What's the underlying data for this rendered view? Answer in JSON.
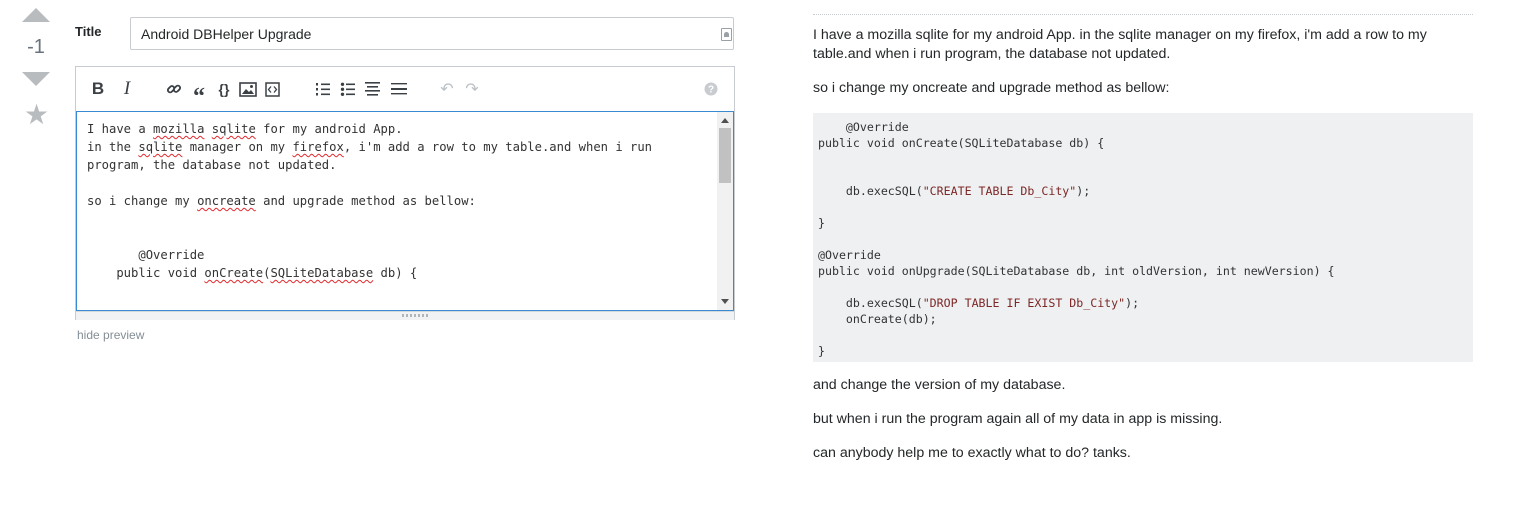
{
  "vote": {
    "score": "-1"
  },
  "title": {
    "label": "Title",
    "value": "Android DBHelper Upgrade"
  },
  "toolbar": {
    "bold_label": "B",
    "italic_label": "I",
    "icons": [
      "link-icon",
      "quote-icon",
      "code-icon",
      "image-icon",
      "snippet-icon",
      "ordered-list-icon",
      "bulleted-list-icon",
      "heading-icon",
      "horizontal-rule-icon",
      "undo-icon",
      "redo-icon",
      "help-icon"
    ]
  },
  "editor": {
    "lines": [
      {
        "parts": [
          {
            "t": "I have a "
          },
          {
            "t": "mozilla",
            "s": true
          },
          {
            "t": " "
          },
          {
            "t": "sqlite",
            "s": true
          },
          {
            "t": " for my android App."
          }
        ]
      },
      {
        "parts": [
          {
            "t": "in the "
          },
          {
            "t": "sqlite",
            "s": true
          },
          {
            "t": " manager on my "
          },
          {
            "t": "firefox",
            "s": true
          },
          {
            "t": ", i'm add a row to my table.and when i run"
          }
        ]
      },
      {
        "parts": [
          {
            "t": "program, the database not updated."
          }
        ]
      },
      {
        "parts": [
          {
            "t": ""
          }
        ]
      },
      {
        "parts": [
          {
            "t": "so i change my "
          },
          {
            "t": "oncreate",
            "s": true
          },
          {
            "t": " and upgrade method as bellow:"
          }
        ]
      },
      {
        "parts": [
          {
            "t": ""
          }
        ]
      },
      {
        "parts": [
          {
            "t": ""
          }
        ]
      },
      {
        "parts": [
          {
            "t": "       @Override"
          }
        ]
      },
      {
        "parts": [
          {
            "t": "    public void "
          },
          {
            "t": "onCreate",
            "s": true
          },
          {
            "t": "("
          },
          {
            "t": "SQLiteDatabase",
            "s": true
          },
          {
            "t": " db) {"
          }
        ]
      },
      {
        "parts": [
          {
            "t": ""
          }
        ]
      }
    ]
  },
  "hide_preview_label": "hide preview",
  "preview": {
    "p1": "I have a mozilla sqlite for my android App. in the sqlite manager on my firefox, i'm add a row to my table.and when i run program, the database not updated.",
    "p2": "so i change my oncreate and upgrade method as bellow:",
    "code": [
      {
        "parts": [
          {
            "t": "    @Override"
          }
        ]
      },
      {
        "parts": [
          {
            "t": "public void onCreate(SQLiteDatabase db) {"
          }
        ]
      },
      {
        "parts": [
          {
            "t": ""
          }
        ]
      },
      {
        "parts": [
          {
            "t": ""
          }
        ]
      },
      {
        "parts": [
          {
            "t": "    db.execSQL("
          },
          {
            "t": "\"CREATE TABLE Db_City\"",
            "str": true
          },
          {
            "t": ");"
          }
        ]
      },
      {
        "parts": [
          {
            "t": ""
          }
        ]
      },
      {
        "parts": [
          {
            "t": "}"
          }
        ]
      },
      {
        "parts": [
          {
            "t": ""
          }
        ]
      },
      {
        "parts": [
          {
            "t": "@Override"
          }
        ]
      },
      {
        "parts": [
          {
            "t": "public void onUpgrade(SQLiteDatabase db, int oldVersion, int newVersion) {"
          }
        ]
      },
      {
        "parts": [
          {
            "t": ""
          }
        ]
      },
      {
        "parts": [
          {
            "t": "    db.execSQL("
          },
          {
            "t": "\"DROP TABLE IF EXIST Db_City\"",
            "str": true
          },
          {
            "t": ");"
          }
        ]
      },
      {
        "parts": [
          {
            "t": "    onCreate(db);"
          }
        ]
      },
      {
        "parts": [
          {
            "t": ""
          }
        ]
      },
      {
        "parts": [
          {
            "t": "}"
          }
        ]
      }
    ],
    "p3": "and change the version of my database.",
    "p4": "but when i run the program again all of my data in app is missing.",
    "p5": "can anybody help me to exactly what to do? tanks."
  }
}
